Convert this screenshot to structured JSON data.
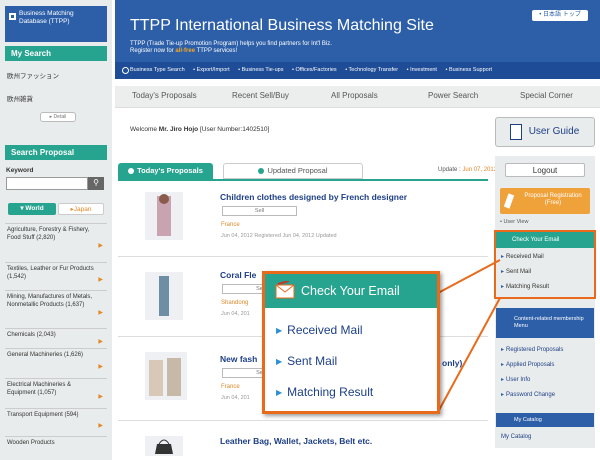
{
  "left": {
    "db_label": "Business Matching Database (TTPP)",
    "my_search": "My Search",
    "my_search_items": [
      "欧州ファッション",
      "欧州雑貨"
    ],
    "detail_btn": "▸ Detail",
    "search_proposal": "Search Proposal",
    "keyword_label": "Keyword",
    "search_icon": "magnifier-icon",
    "tab_world": "▾ World",
    "tab_japan": "▸Japan",
    "categories": [
      "Agriculture, Forestry & Fishery, Food Stuff (2,820)",
      "Textiles, Leather or Fur Products (1,542)",
      "Mining, Manufactures of Metals, Nonmetallic Products (1,637)",
      "Chemicals (2,043)",
      "General Machineries (1,626)",
      "Electrical Machineries & Equipment (1,057)",
      "Transport Equipment (594)",
      "Wooden Products"
    ]
  },
  "header": {
    "title": "TTPP International Business Matching Site",
    "subtitle_1": "TTPP (Trade Tie-up Promotion Program) helps you find partners for Int'l Biz.",
    "subtitle_2a": "Register now for ",
    "subtitle_2b": "all-free",
    "subtitle_2c": " TTPP services!",
    "lang_btn": "• 日本語 トップ",
    "nav": [
      "Business Type Search",
      "• Export/Import",
      "• Business Tie-ups",
      "• Offices/Factories",
      "• Technology Transfer",
      "• Investment",
      "• Business Support"
    ]
  },
  "tabs": [
    "Today's Proposals",
    "Recent Sell/Buy",
    "All Proposals",
    "Power Search",
    "Special Corner"
  ],
  "welcome": {
    "prefix": "Welcome ",
    "name": "Mr. Jiro Hojo",
    "user": " [User Number:1402510]"
  },
  "proposals": {
    "tab_today": "Today's Proposals",
    "tab_updated": "Updated Proposal",
    "update_label": "Update : ",
    "update_date": "Jun 07, 2012",
    "items": [
      {
        "title": "Children clothes designed by French designer",
        "type": "Sell",
        "country": "France",
        "date": "Jun 04, 2012 Registered   Jun 04, 2012 Updated"
      },
      {
        "title": "Coral Fle",
        "type": "Se",
        "country": "Shandong",
        "date": "Jun 04, 201"
      },
      {
        "title": "New fash",
        "title_tail": "only)",
        "type": "Se",
        "country": "France",
        "date": "Jun 04, 201"
      },
      {
        "title": "Leather Bag, Wallet, Jackets, Belt etc."
      }
    ]
  },
  "right": {
    "user_guide": "User Guide",
    "logout": "Logout",
    "proposal_reg": "Proposal Registration (Free)",
    "user_view": "• User View",
    "check_email": "Check Your Email",
    "email_items": [
      "Received Mail",
      "Sent Mail",
      "Matching Result"
    ],
    "mgmt_header": "Content-related membership Menu",
    "mgmt_items": [
      "Registered Proposals",
      "Applied Proposals",
      "User Info",
      "Password Change"
    ],
    "my_catalog_hdr": "My Catalog",
    "my_catalog": "My Catalog"
  },
  "callout": {
    "title": "Check Your Email",
    "icon": "mail-icon",
    "items": [
      "Received Mail",
      "Sent Mail",
      "Matching Result"
    ]
  },
  "colors": {
    "brand_blue": "#2d5fa8",
    "teal": "#27a48f",
    "orange": "#e86a1a"
  }
}
